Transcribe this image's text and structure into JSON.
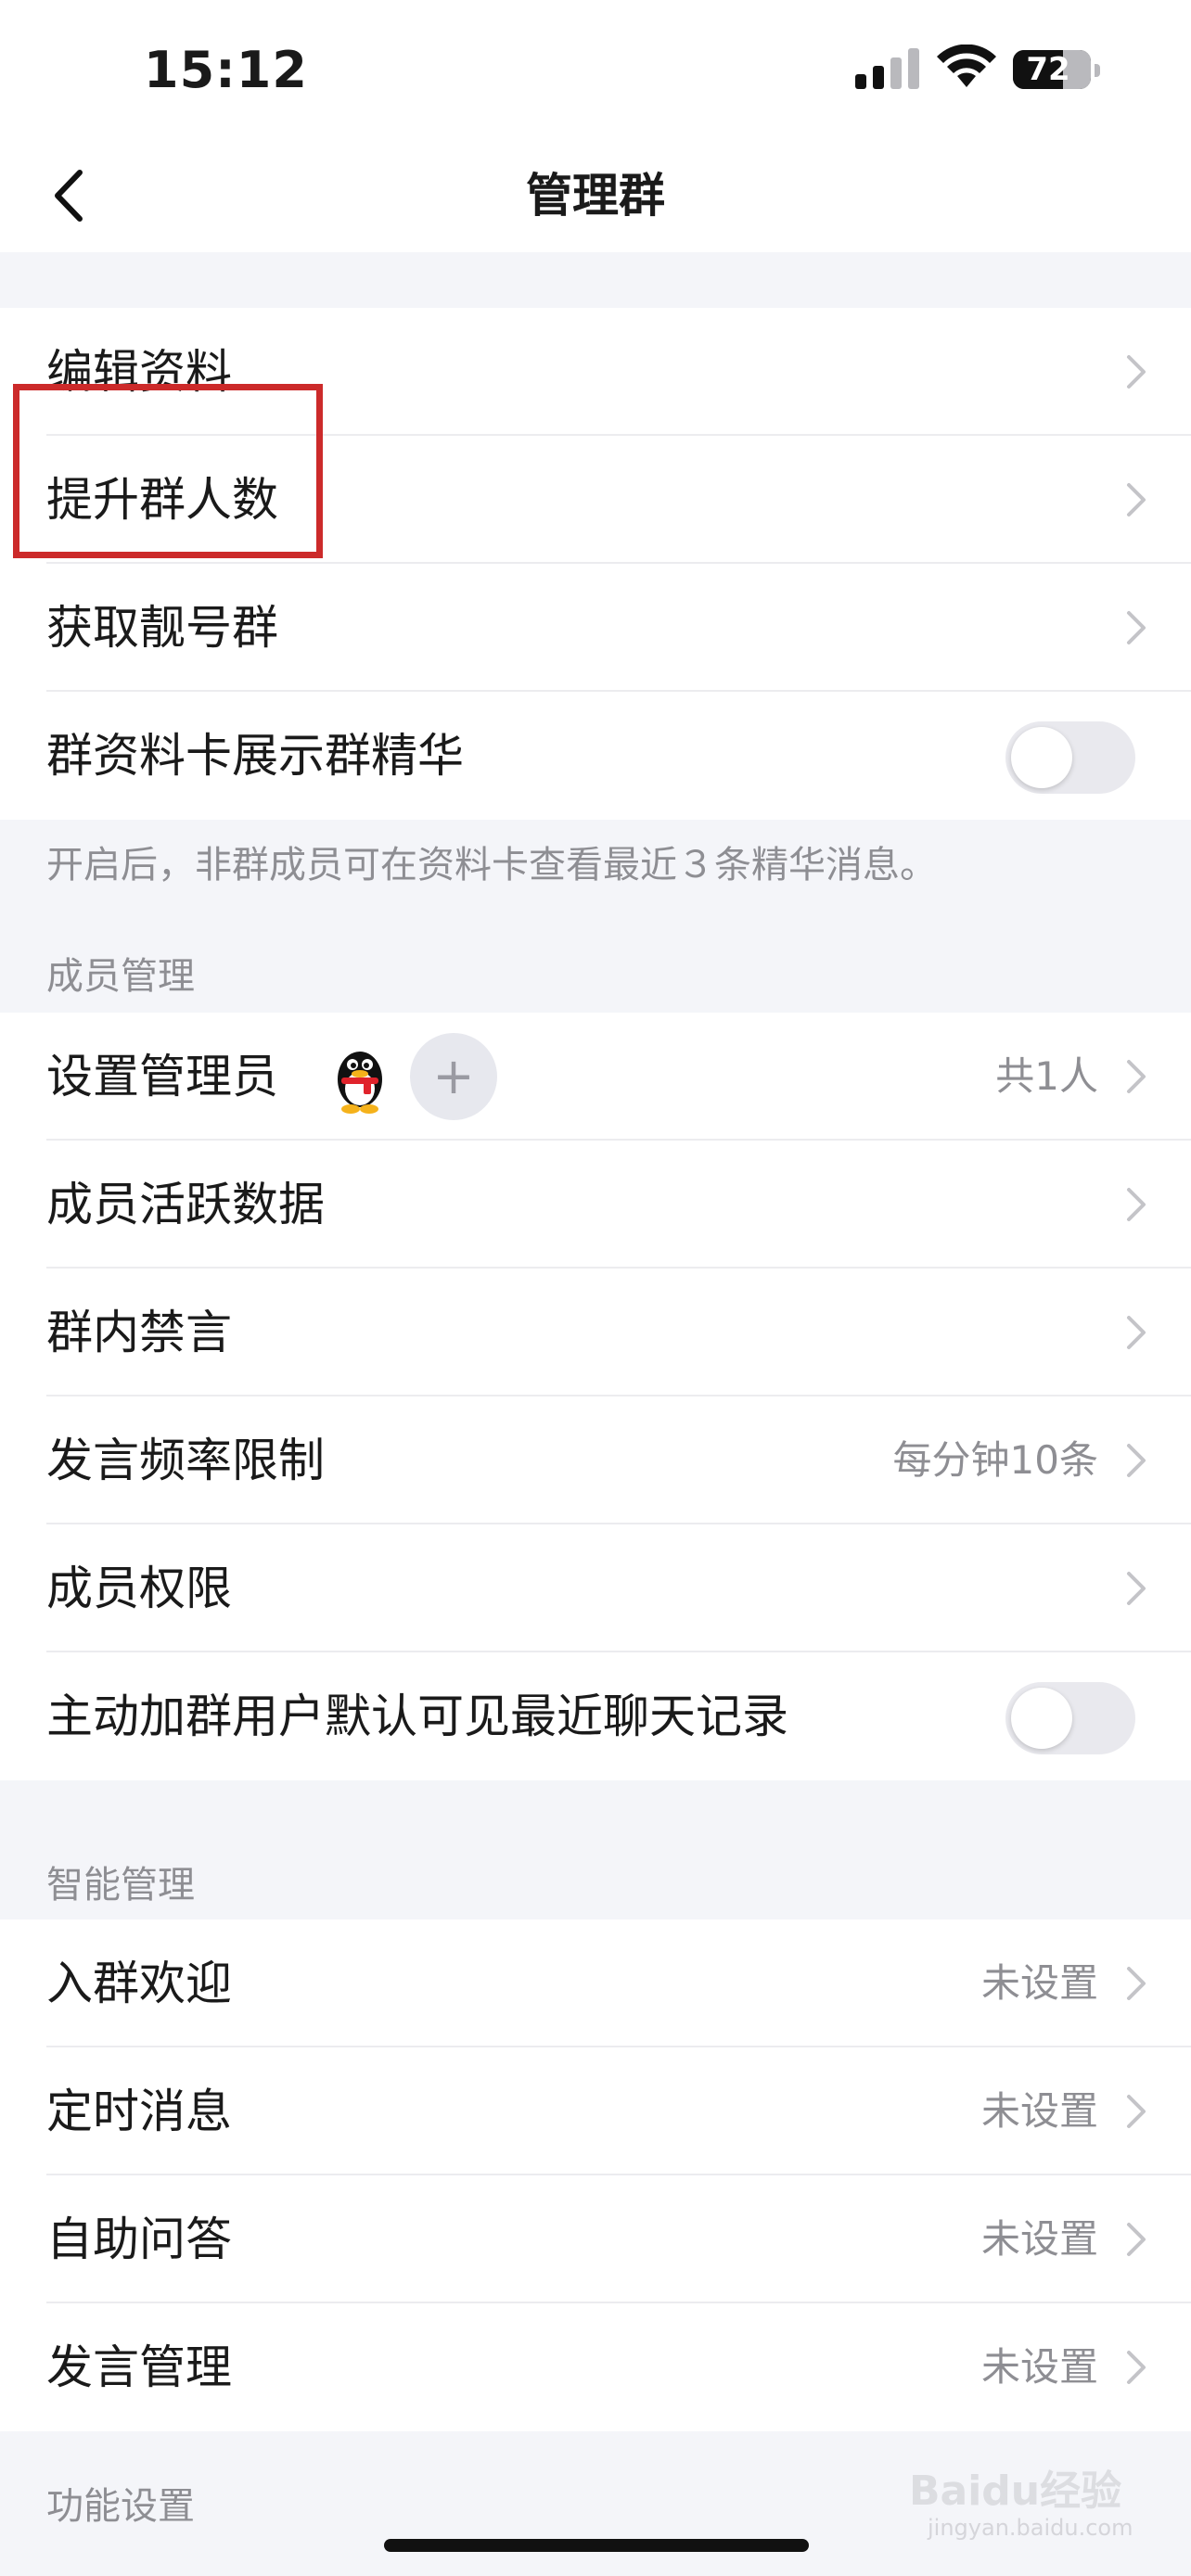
{
  "status_bar": {
    "time": "15:12",
    "battery": "72"
  },
  "nav": {
    "title": "管理群"
  },
  "group1": {
    "items": [
      {
        "label": "编辑资料"
      },
      {
        "label": "提升群人数"
      },
      {
        "label": "获取靓号群"
      },
      {
        "label": "群资料卡展示群精华",
        "toggle": false
      }
    ],
    "note": "开启后，非群成员可在资料卡查看最近３条精华消息。"
  },
  "member_mgmt": {
    "title": "成员管理",
    "items": [
      {
        "label": "设置管理员",
        "value": "共1人"
      },
      {
        "label": "成员活跃数据"
      },
      {
        "label": "群内禁言"
      },
      {
        "label": "发言频率限制",
        "value": "每分钟10条"
      },
      {
        "label": "成员权限"
      },
      {
        "label": "主动加群用户默认可见最近聊天记录",
        "toggle": false
      }
    ]
  },
  "smart_mgmt": {
    "title": "智能管理",
    "items": [
      {
        "label": "入群欢迎",
        "value": "未设置"
      },
      {
        "label": "定时消息",
        "value": "未设置"
      },
      {
        "label": "自助问答",
        "value": "未设置"
      },
      {
        "label": "发言管理",
        "value": "未设置"
      }
    ]
  },
  "feature_settings": {
    "title": "功能设置"
  },
  "watermark": {
    "text": "Baidu经验",
    "sub": "jingyan.baidu.com"
  },
  "colors": {
    "highlight": "#cc2a2a",
    "background": "#f4f5f9",
    "toggle_off": "#e9e9ee"
  }
}
